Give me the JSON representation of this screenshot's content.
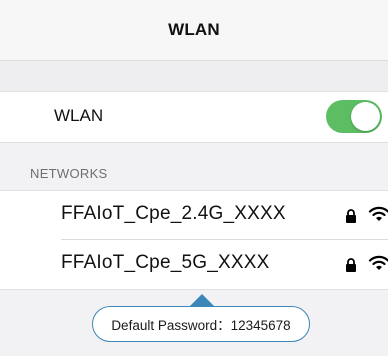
{
  "header": {
    "title": "WLAN"
  },
  "wlan": {
    "label": "WLAN",
    "enabled": true,
    "toggle_color": "#5cbd62"
  },
  "networks": {
    "section_title": "NETWORKS",
    "items": [
      {
        "ssid": "FFAIoT_Cpe_2.4G_XXXX",
        "icons": [
          "lock-icon",
          "wifi-icon"
        ]
      },
      {
        "ssid": "FFAIoT_Cpe_5G_XXXX",
        "icons": [
          "lock-icon",
          "wifi-icon"
        ]
      }
    ]
  },
  "tooltip": {
    "text": "Default Password：12345678",
    "border_color": "#3d86b8"
  }
}
